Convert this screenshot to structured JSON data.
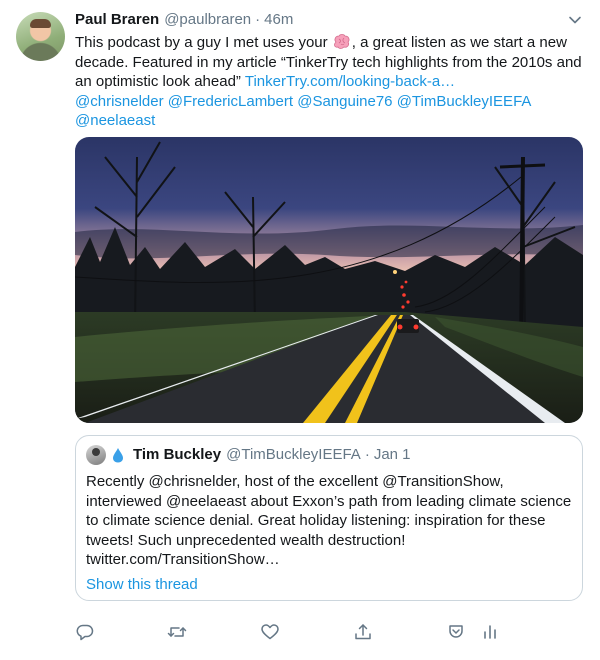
{
  "tweet": {
    "name": "Paul Braren",
    "handle": "@paulbraren",
    "separator": "·",
    "time": "46m",
    "text_part1": "This podcast by a guy I met uses your",
    "text_part2": ", a great listen as we start a new decade. Featured in my article “TinkerTry tech highlights from the 2010s and an optimistic look ahead”",
    "link": "TinkerTry.com/looking-back-a…",
    "mentions": [
      "@chrisnelder",
      "@FredericLambert",
      "@Sanguine76",
      "@TimBuckleyIEEFA",
      "@neelaeast"
    ]
  },
  "quote": {
    "name": "Tim Buckley",
    "handle": "@TimBuckleyIEEFA",
    "separator": "·",
    "date": "Jan 1",
    "text": "Recently @chrisnelder, host of the excellent @TransitionShow, interviewed @neelaeast about Exxon’s path from leading climate science to climate science denial. Great holiday listening: inspiration for these tweets! Such unprecedented wealth destruction!",
    "url": "twitter.com/TransitionShow…",
    "show_thread": "Show this thread"
  },
  "icons": [
    "chevron-down-icon",
    "brain-emoji-icon",
    "water-drop-icon",
    "reply-icon",
    "retweet-icon",
    "like-icon",
    "share-icon",
    "bookmark-icon",
    "analytics-icon"
  ],
  "colors": {
    "link": "#1b95e0",
    "muted": "#657786",
    "text": "#14171a",
    "border": "#ccd6dd"
  }
}
